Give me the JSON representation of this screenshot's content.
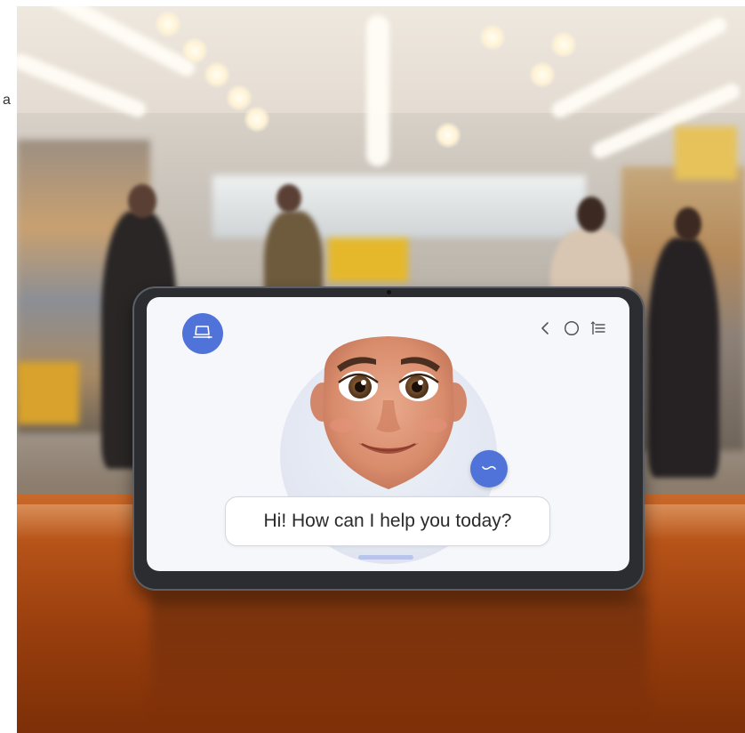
{
  "page": {
    "stray_text": "a"
  },
  "tablet_ui": {
    "menu_icon": "laptop-icon",
    "top_icons": [
      "back-chevron-icon",
      "home-circle-icon",
      "list-menu-icon"
    ],
    "mic_icon": "wave-icon",
    "speech_bubble": "Hi! How can I help you today?",
    "accent_color": "#4f73d8"
  }
}
